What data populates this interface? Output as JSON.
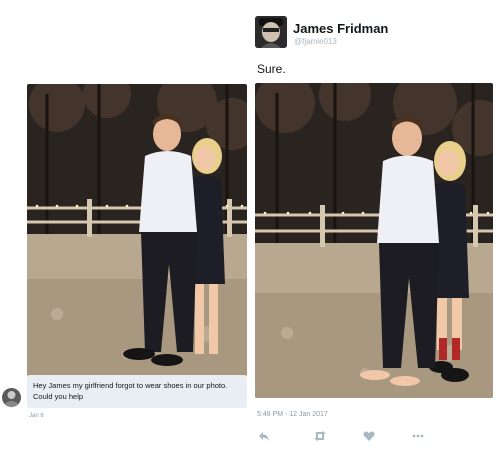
{
  "left_tweet": {
    "message": "Hey James my girlfriend forgot to wear shoes in our photo. Could you help",
    "date": "Jan 6"
  },
  "right_tweet": {
    "author_name": "James Fridman",
    "author_handle": "@fjamie013",
    "reply_text": "Sure.",
    "timestamp": "5:48 PM - 12 Jan 2017",
    "actions": [
      "reply-icon",
      "retweet-icon",
      "like-icon",
      "more-icon"
    ]
  },
  "colors": {
    "bubble_bg": "#e8eef3",
    "meta_text": "#8899a6",
    "action_icons": "#aab8c2"
  }
}
